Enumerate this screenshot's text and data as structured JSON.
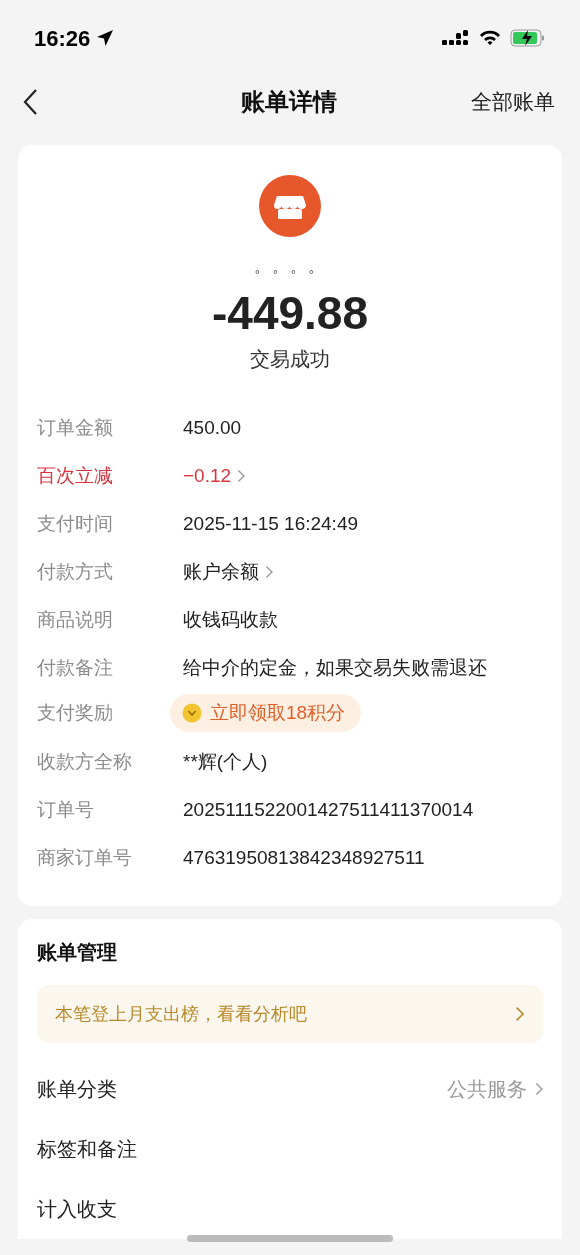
{
  "status_bar": {
    "time": "16:26"
  },
  "nav": {
    "title": "账单详情",
    "action": "全部账单"
  },
  "summary": {
    "merchant": "。。。。",
    "amount": "-449.88",
    "status": "交易成功"
  },
  "details": [
    {
      "kind": "text",
      "label": "订单金额",
      "value": "450.00"
    },
    {
      "kind": "discount",
      "label": "百次立减",
      "value": "−0.12"
    },
    {
      "kind": "text",
      "label": "支付时间",
      "value": "2025-11-15 16:24:49"
    },
    {
      "kind": "link",
      "label": "付款方式",
      "value": "账户余额"
    },
    {
      "kind": "text",
      "label": "商品说明",
      "value": "收钱码收款"
    },
    {
      "kind": "text",
      "label": "付款备注",
      "value": "给中介的定金，如果交易失败需退还"
    },
    {
      "kind": "reward",
      "label": "支付奖励",
      "value": "立即领取18积分"
    },
    {
      "kind": "text",
      "label": "收款方全称",
      "value": "**辉(个人)"
    },
    {
      "kind": "text",
      "label": "订单号",
      "value": "2025111522001427511411370014"
    },
    {
      "kind": "text",
      "label": "商家订单号",
      "value": "47631950813842348927511"
    }
  ],
  "management": {
    "title": "账单管理",
    "banner": "本笔登上月支出榜，看看分析吧",
    "rows": [
      {
        "label": "账单分类",
        "value": "公共服务"
      },
      {
        "label": "标签和备注"
      },
      {
        "label": "计入收支"
      }
    ]
  }
}
